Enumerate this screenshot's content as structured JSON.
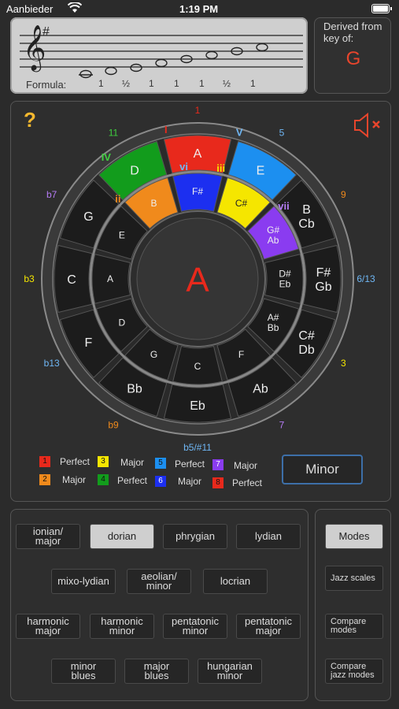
{
  "status": {
    "carrier": "Aanbieder",
    "time": "1:19 PM",
    "wifi_icon": "wifi-icon",
    "battery_icon": "battery-icon"
  },
  "staff": {
    "formula_label": "Formula:",
    "intervals": [
      "1",
      "½",
      "1",
      "1",
      "1",
      "½",
      "1"
    ],
    "clef_icon": "treble-clef-icon",
    "key_signature": "#"
  },
  "derived": {
    "label": "Derived from\nkey of:",
    "key": "G"
  },
  "wheel": {
    "help": "?",
    "center": "A",
    "speaker_icon": "speaker-muted-icon",
    "outer_notes": [
      "A",
      "E",
      "B Cb",
      "F# Gb",
      "C# Db",
      "Ab",
      "Eb",
      "Bb",
      "F",
      "C",
      "G",
      "D"
    ],
    "inner_notes": [
      "F#",
      "C#",
      "G# Ab",
      "D# Eb",
      "A# Bb",
      "F",
      "C",
      "G",
      "D",
      "A",
      "E",
      "B"
    ],
    "degree_labels": [
      "1",
      "5",
      "9",
      "6/13",
      "3",
      "7",
      "b5/#11",
      "b9",
      "b13",
      "b3",
      "b7",
      "11"
    ],
    "roman": [
      "I",
      "V",
      "vi",
      "iii",
      "vii",
      "ii",
      "IV"
    ]
  },
  "legend": [
    {
      "num": "1",
      "text": "Perfect",
      "color": "#e8291c"
    },
    {
      "num": "2",
      "text": "Major",
      "color": "#f08a1c"
    },
    {
      "num": "3",
      "text": "Major",
      "color": "#f5e600"
    },
    {
      "num": "4",
      "text": "Perfect",
      "color": "#129c1c"
    },
    {
      "num": "5",
      "text": "Perfect",
      "color": "#1c8ff0"
    },
    {
      "num": "6",
      "text": "Major",
      "color": "#1c2ff0"
    },
    {
      "num": "7",
      "text": "Major",
      "color": "#8a3cf0"
    },
    {
      "num": "8",
      "text": "Perfect",
      "color": "#e8291c"
    }
  ],
  "minor_button": "Minor",
  "scales": [
    "ionian/\nmajor",
    "dorian",
    "phrygian",
    "lydian",
    "mixo-lydian",
    "aeolian/\nminor",
    "locrian",
    "harmonic\nmajor",
    "harmonic\nminor",
    "pentatonic\nminor",
    "pentatonic\nmajor",
    "minor\nblues",
    "major\nblues",
    "hungarian\nminor"
  ],
  "modes": [
    "Modes",
    "Jazz scales",
    "Compare\nmodes",
    "Compare\njazz modes"
  ],
  "colors": {
    "accent": "#e8452c",
    "blue_outline": "#3d6fa8"
  }
}
